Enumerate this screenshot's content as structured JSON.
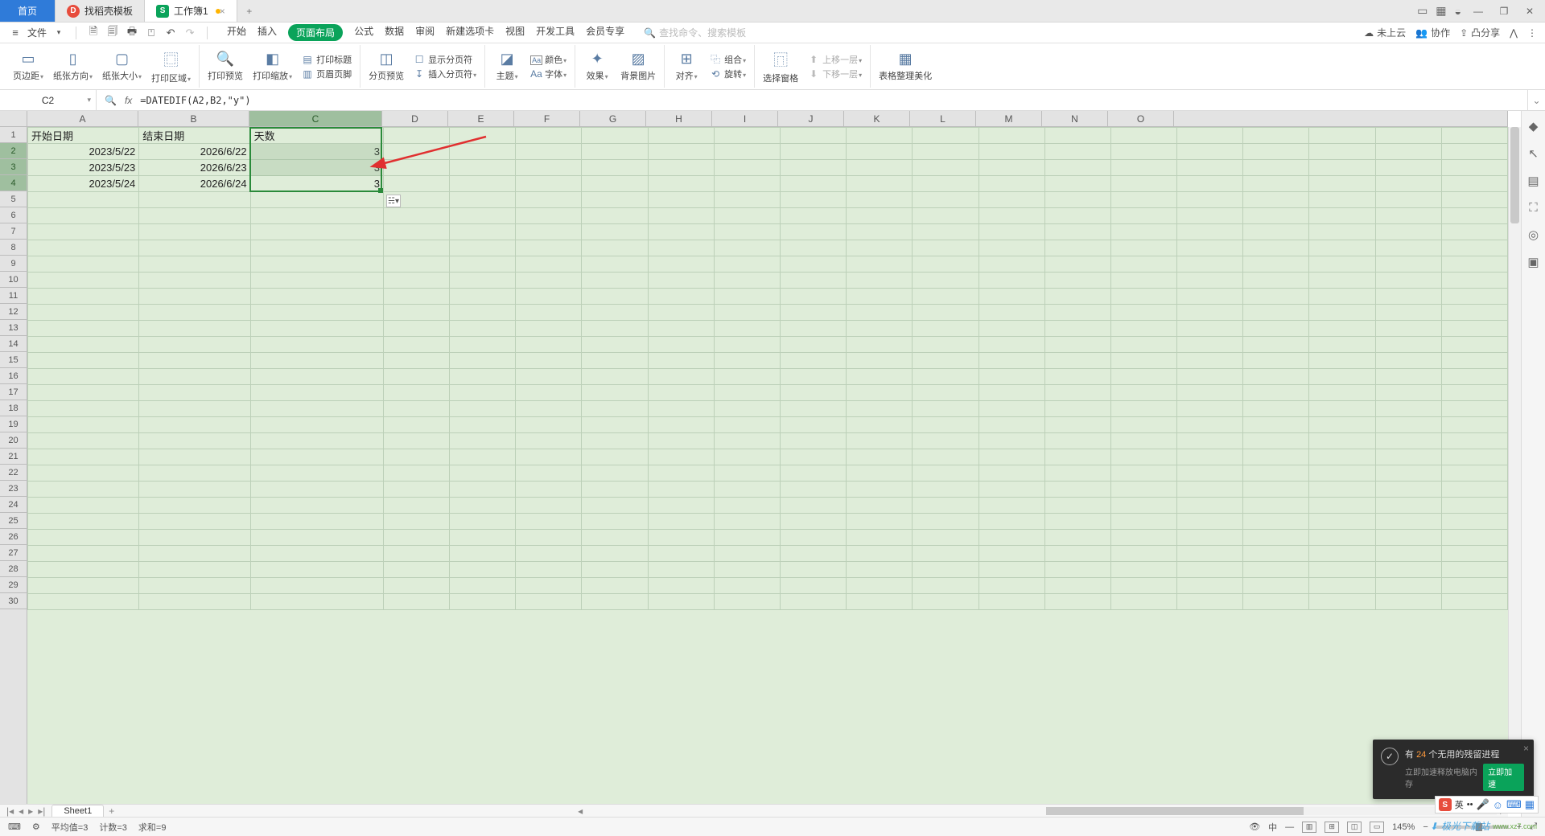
{
  "tabs": {
    "home": "首页",
    "t1": "找稻壳模板",
    "t2": "工作簿1",
    "t2_badge_char": "S"
  },
  "window": {
    "grid_icon": "▦",
    "avatar": "◒",
    "min": "—",
    "restore": "❐",
    "close": "✕",
    "layout": "▭"
  },
  "qat": {
    "menu_icon": "≡",
    "file": "文件",
    "dd": "▾",
    "icons": [
      "🗎",
      "🗐",
      "🖶",
      "⍞",
      "↶",
      "↷"
    ],
    "menus": [
      "开始",
      "插入",
      "页面布局",
      "公式",
      "数据",
      "审阅",
      "新建选项卡",
      "视图",
      "开发工具",
      "会员专享"
    ],
    "active_index": 2,
    "search_icon": "🔍",
    "search_placeholder": "查找命令、搜索模板",
    "right": {
      "cloud_icon": "☁",
      "cloud": "未上云",
      "coop_icon": "👥",
      "coop": "协作",
      "share_icon": "⇪",
      "share": "凸分享",
      "wrench": "⋀",
      "more": "⋮"
    }
  },
  "ribbon": {
    "g1": [
      {
        "ic": "▭",
        "label": "页边距",
        "dd": true
      },
      {
        "ic": "▯",
        "label": "纸张方向",
        "dd": true
      },
      {
        "ic": "▢",
        "label": "纸张大小",
        "dd": true
      },
      {
        "ic": "⿴",
        "label": "打印区域",
        "dd": true
      }
    ],
    "g2": [
      {
        "ic": "🔍",
        "label": "打印预览"
      },
      {
        "ic": "◧",
        "label": "打印缩放",
        "dd": true
      }
    ],
    "g2s": [
      {
        "ic": "▤",
        "label": "打印标题"
      },
      {
        "ic": "▥",
        "label": "页眉页脚"
      }
    ],
    "g3": [
      {
        "ic": "◫",
        "label": "分页预览"
      }
    ],
    "g3s": [
      {
        "ic": "☐",
        "label": "显示分页符"
      },
      {
        "ic": "↧",
        "label": "插入分页符",
        "dd": true
      }
    ],
    "g4": [
      {
        "ic": "◪",
        "label": "主题",
        "dd": true
      }
    ],
    "g4s": [
      {
        "ic": "Aa",
        "label": "颜色",
        "dd": true,
        "box": true
      },
      {
        "ic": "Aa",
        "label": "字体",
        "dd": true
      }
    ],
    "g5": [
      {
        "ic": "✦",
        "label": "效果",
        "dd": true
      },
      {
        "ic": "▨",
        "label": "背景图片"
      }
    ],
    "g6": [
      {
        "ic": "⊞",
        "label": "对齐",
        "dd": true
      }
    ],
    "g6s": [
      {
        "ic": "⿻",
        "label": "组合",
        "dd": true
      },
      {
        "ic": "⟲",
        "label": "旋转",
        "dd": true
      }
    ],
    "g7": [
      {
        "ic": "⿵",
        "label": "选择窗格"
      }
    ],
    "g7s": [
      {
        "ic": "⬆",
        "label": "上移一层",
        "dd": true,
        "gray": true
      },
      {
        "ic": "⬇",
        "label": "下移一层",
        "dd": true,
        "gray": true
      }
    ],
    "g8": [
      {
        "ic": "▦",
        "label": "表格整理美化"
      }
    ]
  },
  "formula": {
    "cell_ref": "C2",
    "fx": "fx",
    "value": "=DATEDIF(A2,B2,\"y\")",
    "expand": "⌄",
    "search": "🔍"
  },
  "columns": [
    "A",
    "B",
    "C",
    "D",
    "E",
    "F",
    "G",
    "H",
    "I",
    "J",
    "K",
    "L",
    "M",
    "N",
    "O"
  ],
  "grid": {
    "headers": [
      "开始日期",
      "结束日期",
      "天数"
    ],
    "rows": [
      {
        "a": "2023/5/22",
        "b": "2026/6/22",
        "c": "3"
      },
      {
        "a": "2023/5/23",
        "b": "2026/6/23",
        "c": "3"
      },
      {
        "a": "2023/5/24",
        "b": "2026/6/24",
        "c": "3"
      }
    ],
    "autofill": "☵▾",
    "total_visible_rows": 30
  },
  "side_icons": [
    "◆",
    "↖",
    "▤",
    "⛶",
    "◎",
    "▣"
  ],
  "sheetbar": {
    "nav": [
      "|◂",
      "◂",
      "▸",
      "▸|"
    ],
    "sheet": "Sheet1",
    "add": "+"
  },
  "status": {
    "left_icons": [
      "⌨",
      "⚙"
    ],
    "avg_label": "平均值=",
    "avg": "3",
    "count_label": "计数=",
    "count": "3",
    "sum_label": "求和=",
    "sum": "9",
    "views": [
      "👁",
      "▦",
      "—",
      "▥",
      "⊞",
      "◫",
      "▭"
    ],
    "zoom": "145%",
    "minus": "−",
    "plus": "+",
    "expand": "⤢"
  },
  "toast": {
    "shield": "✓",
    "pre": "有 ",
    "num": "24",
    "post": " 个无用的残留进程",
    "line2": "立即加速释放电脑内存",
    "btn": "立即加速",
    "close": "×"
  },
  "ime": {
    "s": "S",
    "lang": "英",
    "dots": "••",
    "mic": "🎤",
    "face": "☺",
    "kb": "⌨",
    "grid": "▦"
  },
  "watermark": {
    "icon": "⬇",
    "text": "极光下载站",
    "sub": "www.xz7.com"
  }
}
